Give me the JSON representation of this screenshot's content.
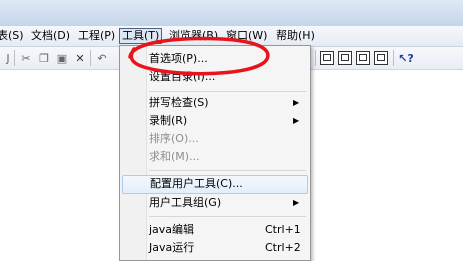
{
  "menubar": {
    "items": [
      {
        "label": "表(S)"
      },
      {
        "label": "文档(D)"
      },
      {
        "label": "工程(P)"
      },
      {
        "label": "工具(T)"
      },
      {
        "label": "浏览器(B)"
      },
      {
        "label": "窗口(W)"
      },
      {
        "label": "帮助(H)"
      }
    ],
    "open_menu": "工具(T)"
  },
  "toolbar": {
    "icons": [
      "separator-icon",
      "cut-icon",
      "copy-icon",
      "paste-icon",
      "delete-icon",
      "undo-icon",
      "view-icon",
      "view-icon",
      "view-icon",
      "view-icon",
      "help-pointer-icon"
    ]
  },
  "tools_menu": {
    "items": [
      {
        "label": "首选项(P)...",
        "state": "normal"
      },
      {
        "label": "设置目录(I)...",
        "state": "normal"
      },
      {
        "label": "拼写检查(S)",
        "state": "normal",
        "submenu": true
      },
      {
        "label": "录制(R)",
        "state": "normal",
        "submenu": true
      },
      {
        "label": "排序(O)...",
        "state": "disabled"
      },
      {
        "label": "求和(M)...",
        "state": "disabled"
      },
      {
        "label": "配置用户工具(C)...",
        "state": "hover"
      },
      {
        "label": "用户工具组(G)",
        "state": "normal",
        "submenu": true
      },
      {
        "label": "java编辑",
        "shortcut": "Ctrl+1",
        "state": "normal"
      },
      {
        "label": "Java运行",
        "shortcut": "Ctrl+2",
        "state": "normal"
      }
    ]
  },
  "annotation": {
    "shape": "ellipse",
    "color": "#e8141c",
    "target": "首选项(P)..."
  },
  "colors": {
    "highlight_border": "#aecbef",
    "disabled_text": "#8d8d8d",
    "annotation": "#e8141c"
  }
}
